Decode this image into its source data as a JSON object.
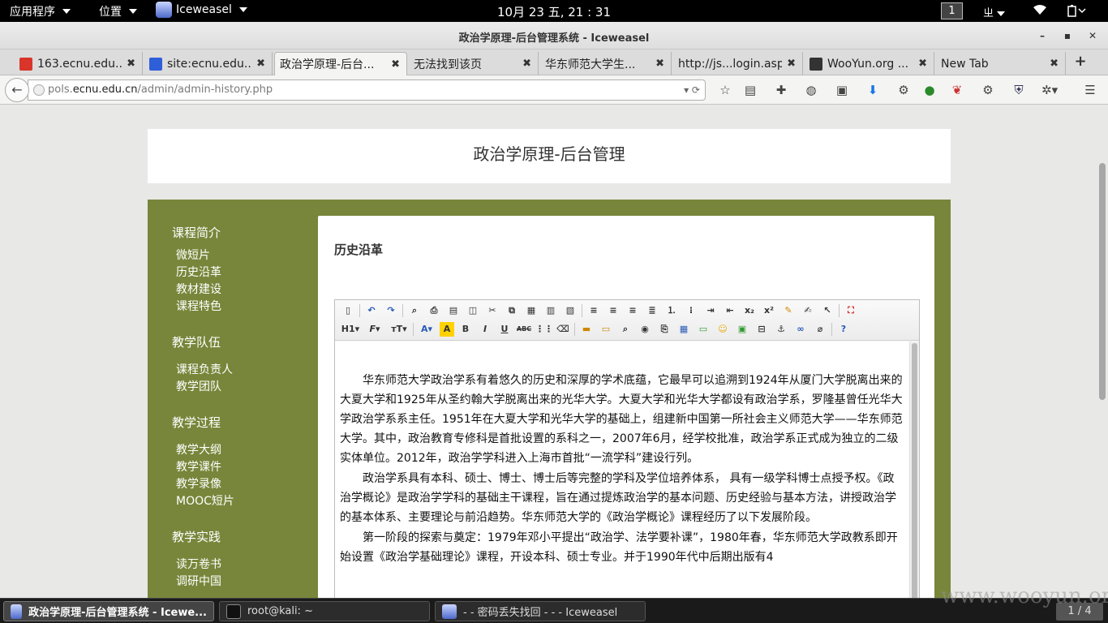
{
  "gnome_bar": {
    "apps_menu": "应用程序",
    "places_menu": "位置",
    "app_name": "Iceweasel",
    "clock": "10月 23 五, 21 : 31",
    "workspace": "1",
    "input_method": "ㄓ"
  },
  "window": {
    "title": "政治学原理-后台管理系统 - Iceweasel"
  },
  "tabs": [
    {
      "label": "163.ecnu.edu....",
      "icon_color": "#d9352a"
    },
    {
      "label": "site:ecnu.edu....",
      "icon_color": "#2e5fd8"
    },
    {
      "label": "政治学原理-后台...",
      "icon_color": ""
    },
    {
      "label": "无法找到该页",
      "icon_color": ""
    },
    {
      "label": "华东师范大学生...",
      "icon_color": ""
    },
    {
      "label": "http://js...login.asp",
      "icon_color": ""
    },
    {
      "label": "WooYun.org ...",
      "icon_color": "#333333"
    },
    {
      "label": "New Tab",
      "icon_color": ""
    }
  ],
  "url": {
    "prefix": "pols.",
    "domain": "ecnu.edu.cn",
    "path": "/admin/admin-history.php"
  },
  "page": {
    "site_title": "政治学原理-后台管理",
    "sidebar": [
      {
        "section": "课程简介",
        "links": [
          "微短片",
          "历史沿革",
          "教材建设",
          "课程特色"
        ]
      },
      {
        "section": "教学队伍",
        "links": [
          "课程负责人",
          "教学团队"
        ]
      },
      {
        "section": "教学过程",
        "links": [
          "教学大纲",
          "教学课件",
          "教学录像",
          "MOOC短片"
        ]
      },
      {
        "section": "教学实践",
        "links": [
          "读万卷书",
          "调研中国"
        ]
      }
    ],
    "panel_title": "历史沿革",
    "editor": {
      "toolbar_row2": {
        "heading": "H1",
        "font": "F",
        "size": "тT",
        "bold": "B",
        "italic": "I",
        "underline": "U",
        "strike": "ABC"
      },
      "paragraphs": [
        "华东师范大学政治学系有着悠久的历史和深厚的学术底蕴，它最早可以追溯到1924年从厦门大学脱离出来的大夏大学和1925年从圣约翰大学脱离出来的光华大学。大夏大学和光华大学都设有政治学系，罗隆基曾任光华大学政治学系系主任。1951年在大夏大学和光华大学的基础上，组建新中国第一所社会主义师范大学——华东师范大学。其中，政治教育专修科是首批设置的系科之一，2007年6月，经学校批准，政治学系正式成为独立的二级实体单位。2012年，政治学学科进入上海市首批“一流学科”建设行列。",
        "政治学系具有本科、硕士、博士、博士后等完整的学科及学位培养体系， 具有一级学科博士点授予权。《政治学概论》是政治学学科的基础主干课程，旨在通过提炼政治学的基本问题、历史经验与基本方法，讲授政治学的基本体系、主要理论与前沿趋势。华东师范大学的《政治学概论》课程经历了以下发展阶段。",
        "第一阶段的探索与奠定：1979年邓小平提出“政治学、法学要补课”，1980年春，华东师范大学政教系即开始设置《政治学基础理论》课程，开设本科、硕士专业。并于1990年代中后期出版有4"
      ]
    }
  },
  "taskbar": {
    "tasks": [
      "政治学原理-后台管理系统 - Icewe...",
      "root@kali: ~",
      "- - 密码丢失找回 - - - Iceweasel"
    ],
    "pager": "1 / 4"
  },
  "watermark": "www.wooyun.org"
}
